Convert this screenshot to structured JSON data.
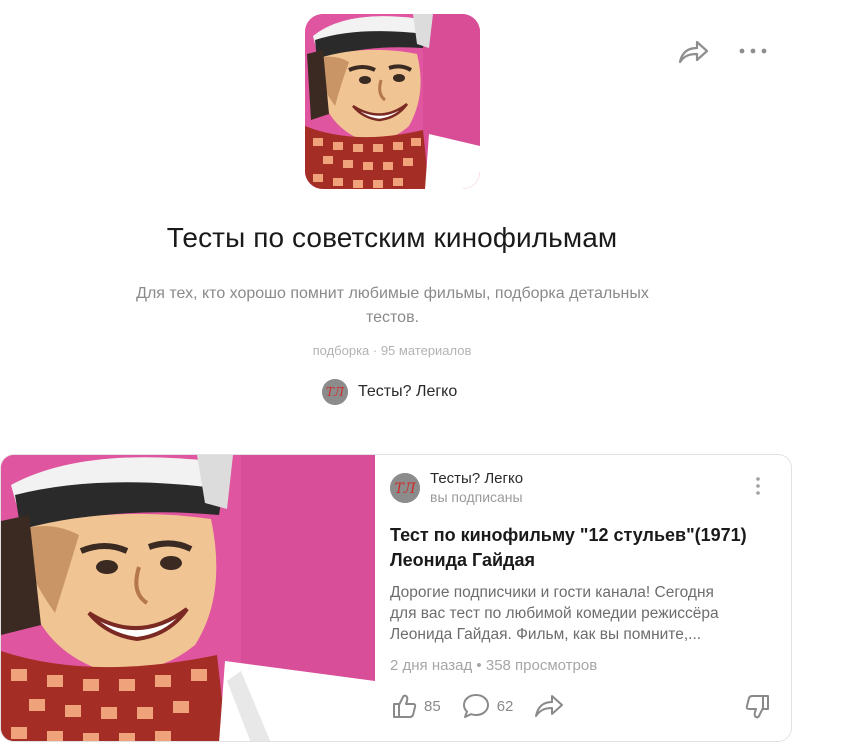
{
  "collection": {
    "title": "Тесты по советским кинофильмам",
    "description_line1": "Для тех, кто хорошо помнит любимые фильмы, подборка детальных",
    "description_line2": "тестов.",
    "meta": "подборка · 95 материалов",
    "author": "Тесты? Легко",
    "author_initials": "ТЛ"
  },
  "icons": {
    "share": "share-arrow-icon",
    "more": "more-dots-icon",
    "like": "thumbs-up-icon",
    "comment": "comment-bubble-icon",
    "dislike": "thumbs-down-icon"
  },
  "article": {
    "channel": "Тесты? Легко",
    "subscribed": "вы подписаны",
    "title_line1": "Тест по кинофильму \"12 стульев\"(1971)",
    "title_line2": "Леонида Гайдая",
    "text_line1": "Дорогие подписчики и гости канала! Сегодня",
    "text_line2": "для вас тест по любимой комедии режиссёра",
    "text_line3": "Леонида Гайдая. Фильм, как вы помните,...",
    "stats": "2 дня назад • 358 просмотров",
    "likes": "85",
    "comments": "62"
  },
  "colors": {
    "cover_background": "#e0559f",
    "avatar_background": "#8c8c8c",
    "avatar_letters": "#d12a2a"
  }
}
